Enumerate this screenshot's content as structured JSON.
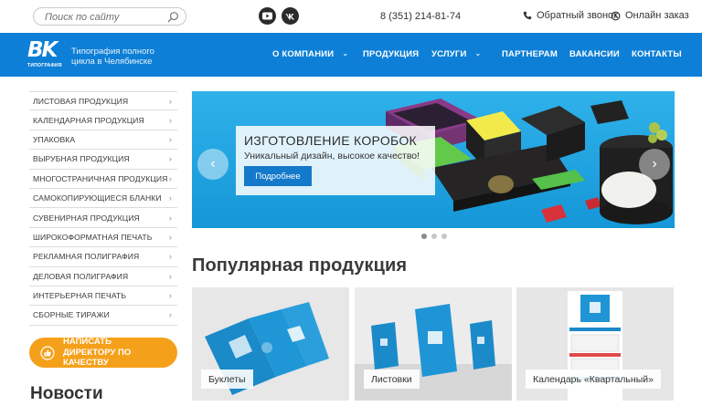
{
  "search": {
    "placeholder": "Поиск по сайту",
    "icon": "search-icon"
  },
  "social": {
    "youtube_icon": "youtube-icon",
    "vk_icon": "vk-icon"
  },
  "contacts": {
    "phone": "8 (351) 214-81-74",
    "callback_label": "Обратный звонок",
    "order_label": "Онлайн заказ"
  },
  "brand": {
    "logo_mark": "BK",
    "logo_sub": "ТИПОГРАФИЯ",
    "tagline": "Типография полного цикла в Челябинске",
    "color": "#0e7fd6"
  },
  "nav": {
    "items": [
      {
        "label": "О КОМПАНИИ",
        "has_dropdown": true
      },
      {
        "label": "ПРОДУКЦИЯ",
        "has_dropdown": false
      },
      {
        "label": "УСЛУГИ",
        "has_dropdown": true
      },
      {
        "label": "ПАРТНЕРАМ",
        "has_dropdown": false
      },
      {
        "label": "ВАКАНСИИ",
        "has_dropdown": false
      },
      {
        "label": "КОНТАКТЫ",
        "has_dropdown": false
      }
    ]
  },
  "sidebar": {
    "items": [
      {
        "label": "ЛИСТОВАЯ ПРОДУКЦИЯ"
      },
      {
        "label": "КАЛЕНДАРНАЯ ПРОДУКЦИЯ"
      },
      {
        "label": "УПАКОВКА"
      },
      {
        "label": "ВЫРУБНАЯ ПРОДУКЦИЯ"
      },
      {
        "label": "МНОГОСТРАНИЧНАЯ ПРОДУКЦИЯ"
      },
      {
        "label": "САМОКОПИРУЮЩИЕСЯ БЛАНКИ"
      },
      {
        "label": "СУВЕНИРНАЯ ПРОДУКЦИЯ"
      },
      {
        "label": "ШИРОКОФОРМАТНАЯ ПЕЧАТЬ"
      },
      {
        "label": "РЕКЛАМНАЯ ПОЛИГРАФИЯ"
      },
      {
        "label": "ДЕЛОВАЯ ПОЛИГРАФИЯ"
      },
      {
        "label": "ИНТЕРЬЕРНАЯ ПЕЧАТЬ"
      },
      {
        "label": "СБОРНЫЕ ТИРАЖИ"
      }
    ],
    "director_button": "НАПИСАТЬ ДИРЕКТОРУ ПО КАЧЕСТВУ",
    "director_color": "#f5a01a"
  },
  "news": {
    "title": "Новости"
  },
  "slider": {
    "title": "ИЗГОТОВЛЕНИЕ КОРОБОК",
    "subtitle": "Уникальный дизайн, высокое качество!",
    "button": "Подробнее",
    "prev_icon": "chevron-left-icon",
    "next_icon": "chevron-right-icon",
    "slides_total": 3,
    "active_slide": 1
  },
  "popular": {
    "title": "Популярная продукция",
    "cards": [
      {
        "label": "Буклеты"
      },
      {
        "label": "Листовки"
      },
      {
        "label": "Календарь «Квартальный»"
      }
    ]
  }
}
